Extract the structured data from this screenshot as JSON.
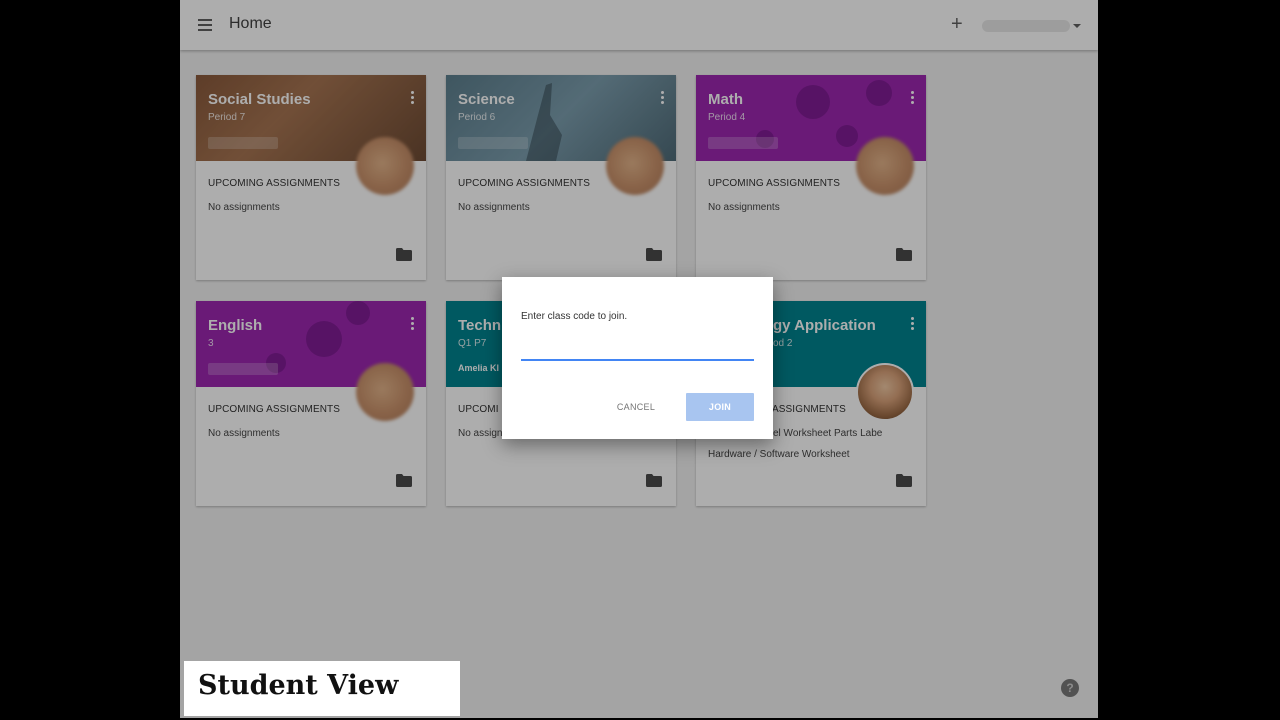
{
  "header": {
    "title": "Home",
    "add_symbol": "+"
  },
  "cards": [
    {
      "title": "Social Studies",
      "subtitle": "Period 7",
      "label": "UPCOMING ASSIGNMENTS",
      "assignments": [
        "No assignments"
      ]
    },
    {
      "title": "Science",
      "subtitle": "Period 6",
      "label": "UPCOMING ASSIGNMENTS",
      "assignments": [
        "No assignments"
      ]
    },
    {
      "title": "Math",
      "subtitle": "Period 4",
      "label": "UPCOMING ASSIGNMENTS",
      "assignments": [
        "No assignments"
      ]
    },
    {
      "title": "English",
      "subtitle": "3",
      "label": "UPCOMING ASSIGNMENTS",
      "assignments": [
        "No assignments"
      ]
    },
    {
      "title": "Techn",
      "subtitle": "Q1 P7",
      "teacher": "Amelia Kl",
      "label": "UPCOMI",
      "assignments": [
        "No assign"
      ]
    },
    {
      "title": "gy Application",
      "subtitle": "od 2",
      "label": "ASSIGNMENTS",
      "assignments": [
        "el Worksheet Parts Labe",
        "Hardware / Software Worksheet"
      ]
    }
  ],
  "dialog": {
    "prompt": "Enter class code to join.",
    "input_value": "",
    "cancel_label": "CANCEL",
    "join_label": "JOIN"
  },
  "help": {
    "symbol": "?"
  },
  "caption": {
    "text": "Student View"
  },
  "colors": {
    "topbar": "#ffffff",
    "purple_header": "#9c27b0",
    "teal_header": "#00838f",
    "input_underline": "#4285f4",
    "join_button": "#a8c5f0"
  }
}
